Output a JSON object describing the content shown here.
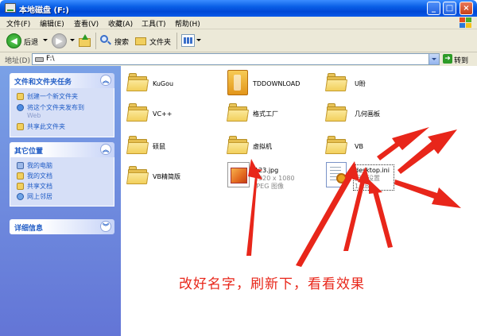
{
  "window": {
    "title": "本地磁盘 (F:)",
    "minimize": "_",
    "maximize": "□",
    "close": "×"
  },
  "menu": [
    "文件(F)",
    "编辑(E)",
    "查看(V)",
    "收藏(A)",
    "工具(T)",
    "帮助(H)"
  ],
  "toolbar": {
    "back": "后退",
    "search": "搜索",
    "folders": "文件夹"
  },
  "address": {
    "label": "地址(D)",
    "value": "F:\\",
    "go": "转到"
  },
  "tasks_panel": {
    "title": "文件和文件夹任务",
    "items": [
      {
        "label": "创建一个新文件夹"
      },
      {
        "label": "将这个文件夹发布到",
        "label2": "Web"
      },
      {
        "label": "共享此文件夹"
      }
    ]
  },
  "places_panel": {
    "title": "其它位置",
    "items": [
      "我的电脑",
      "我的文档",
      "共享文档",
      "网上邻居"
    ]
  },
  "details_panel": {
    "title": "详细信息"
  },
  "files": [
    {
      "name": "KuGou",
      "kind": "folder"
    },
    {
      "name": "TDDOWNLOAD",
      "kind": "tddownload"
    },
    {
      "name": "U盼",
      "kind": "folder"
    },
    {
      "name": "VC++",
      "kind": "folder"
    },
    {
      "name": "格式工厂",
      "kind": "folder"
    },
    {
      "name": "几何画板",
      "kind": "folder"
    },
    {
      "name": "硕鼠",
      "kind": "folder"
    },
    {
      "name": "虚拟机",
      "kind": "folder"
    },
    {
      "name": "VB",
      "kind": "folder"
    },
    {
      "name": "VB精简版",
      "kind": "folder"
    },
    {
      "name": "123.jpg",
      "kind": "jpg",
      "line2": "1920 x 1080",
      "line3": "JPEG 图像"
    },
    {
      "name": "desktop.ini",
      "kind": "ini",
      "line2": "配置设置",
      "line3": "1 KB"
    }
  ],
  "annotation": "改好名字，刷新下，看看效果",
  "colors": {
    "annotation_red": "#e8261a",
    "task_blue": "#215dc6",
    "titlebar_blue": "#0a5fe6"
  }
}
